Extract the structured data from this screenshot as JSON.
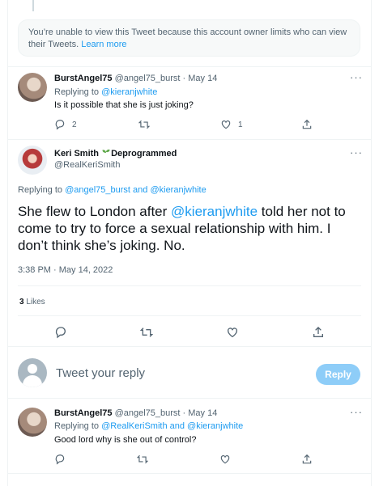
{
  "notice": {
    "text": "You’re unable to view this Tweet because this account owner limits who can view their Tweets.",
    "link": "Learn more"
  },
  "tweet1": {
    "name": "BurstAngel75",
    "handle": "@angel75_burst",
    "dot": " · ",
    "date": "May 14",
    "replying_prefix": "Replying to ",
    "replying_to": "@kieranjwhite",
    "text": "Is it possible that she is just joking?",
    "actions": {
      "reply_count": "2",
      "retweet_count": "",
      "like_count": "1"
    }
  },
  "main_tweet": {
    "name": "Keri Smith",
    "name_suffix": "Deprogrammed",
    "handle": "@RealKeriSmith",
    "replying_prefix": "Replying to ",
    "replying_to_1": "@angel75_burst",
    "replying_and": " and ",
    "replying_to_2": "@kieranjwhite",
    "text_before": "She flew to London after ",
    "mention": "@kieranjwhite",
    "text_after": " told her not to come to try to force a sexual relationship with him. I don’t think she’s joking. No.",
    "timestamp": "3:38 PM · May 14, 2022",
    "likes_count": "3",
    "likes_label": " Likes"
  },
  "compose": {
    "placeholder": "Tweet your reply",
    "button": "Reply"
  },
  "tweet2": {
    "name": "BurstAngel75",
    "handle": "@angel75_burst",
    "dot": " · ",
    "date": "May 14",
    "replying_prefix": "Replying to ",
    "replying_to_1": "@RealKeriSmith",
    "replying_and": " and ",
    "replying_to_2": "@kieranjwhite",
    "text": "Good lord why is she out of control?"
  },
  "icons": {
    "more": "more-horizontal-icon",
    "reply": "reply-icon",
    "retweet": "retweet-icon",
    "like": "heart-icon",
    "share": "share-icon",
    "sprout": "seedling-icon"
  },
  "colors": {
    "accent": "#1d9bf0",
    "muted": "#536471",
    "border": "#eff3f4",
    "reply_button": "#8ecdf8"
  }
}
